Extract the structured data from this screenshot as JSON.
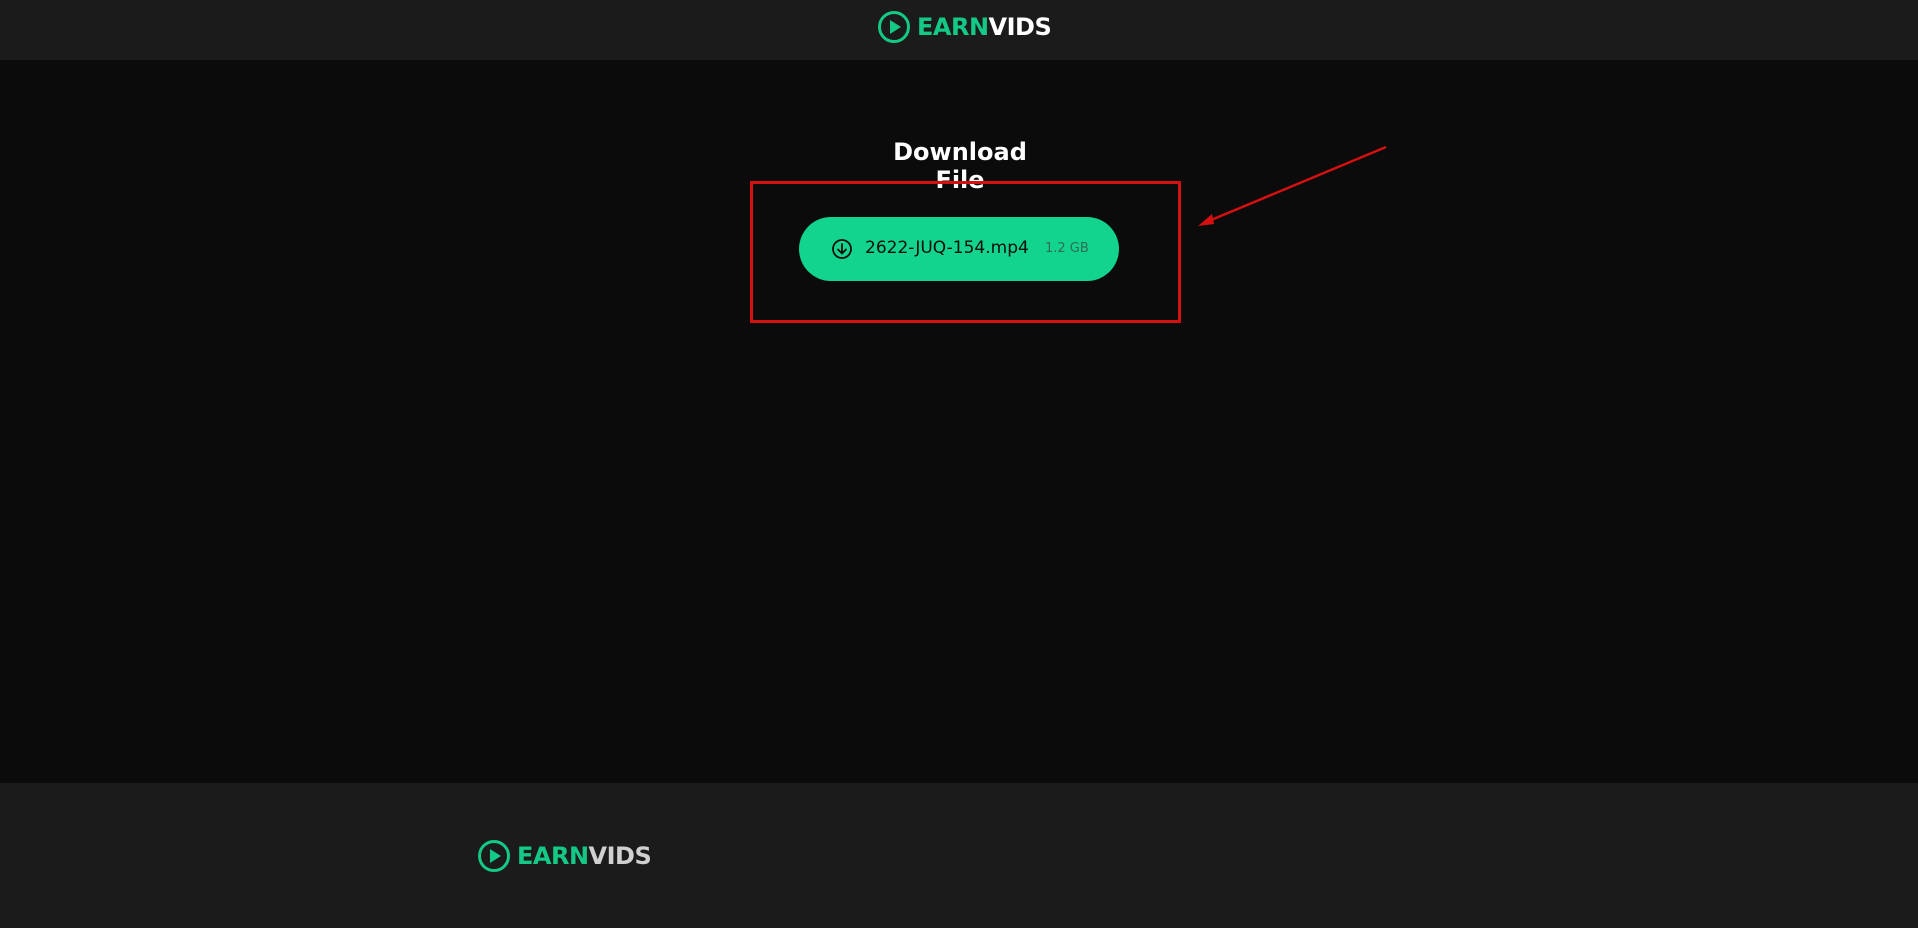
{
  "header": {
    "logo": {
      "earn": "EARN",
      "vids": "VIDS",
      "icon": "play-circle-icon"
    }
  },
  "main": {
    "title": "Download File",
    "download": {
      "filename": "2622-JUQ-154.mp4",
      "size": "1.2 GB",
      "icon": "download-circle-icon"
    },
    "annotation": {
      "box_color": "#d51010",
      "arrow_color": "#d51010"
    }
  },
  "footer": {
    "logo": {
      "earn": "EARN",
      "vids": "VIDS",
      "icon": "play-circle-icon"
    }
  },
  "colors": {
    "accent": "#12d48c",
    "background": "#0b0b0b",
    "header_bg": "#1b1b1b"
  }
}
